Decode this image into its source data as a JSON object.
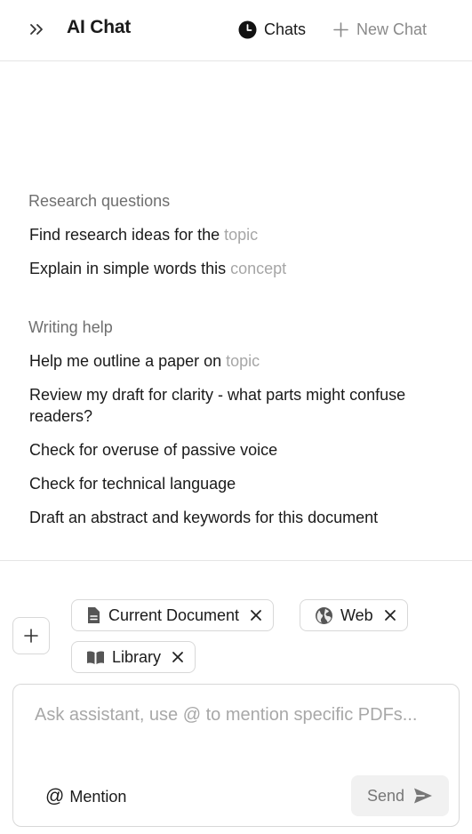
{
  "header": {
    "title": "AI Chat",
    "chats_label": "Chats",
    "new_chat_label": "New Chat"
  },
  "sections": [
    {
      "title": "Research questions",
      "prompts": [
        {
          "text": "Find research ideas for the ",
          "placeholder": "topic"
        },
        {
          "text": "Explain in simple words this ",
          "placeholder": "concept"
        }
      ]
    },
    {
      "title": "Writing help",
      "prompts": [
        {
          "text": "Help me outline a paper on ",
          "placeholder": "topic"
        },
        {
          "text": "Review my draft for clarity - what parts might confuse readers?",
          "placeholder": ""
        },
        {
          "text": "Check for overuse of passive voice",
          "placeholder": ""
        },
        {
          "text": "Check for technical language",
          "placeholder": ""
        },
        {
          "text": "Draft an abstract and keywords for this document",
          "placeholder": ""
        }
      ]
    }
  ],
  "context": {
    "chips": [
      {
        "label": "Current Document",
        "icon": "document-icon"
      },
      {
        "label": "Web",
        "icon": "globe-icon"
      },
      {
        "label": "Library",
        "icon": "book-open-icon"
      }
    ]
  },
  "composer": {
    "value": "",
    "placeholder": "Ask assistant, use @ to mention specific PDFs...",
    "mention_symbol": "@",
    "mention_label": "Mention",
    "send_label": "Send",
    "send_icon": "send-icon"
  }
}
